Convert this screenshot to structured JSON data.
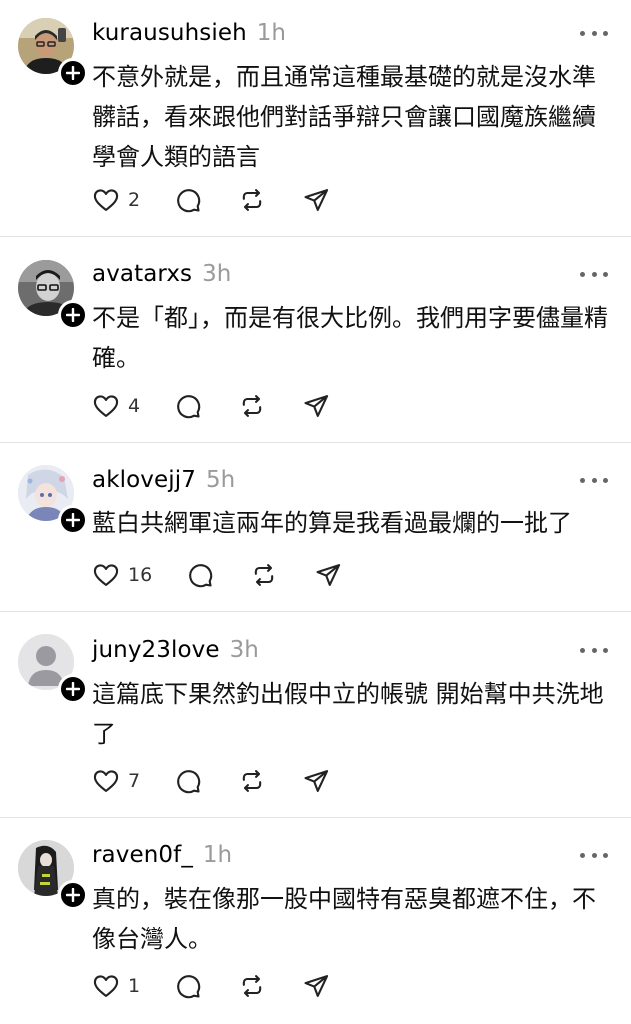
{
  "posts": [
    {
      "username": "kurausuhsieh",
      "time": "1h",
      "text": "不意外就是，而且通常這種最基礎的就是沒水準髒話，看來跟他們對話爭辯只會讓口國魔族繼續學會人類的語言",
      "likes": "2",
      "avatar": "photo-man-glasses"
    },
    {
      "username": "avatarxs",
      "time": "3h",
      "text": "不是「都」，而是有很大比例。我們用字要儘量精確。",
      "likes": "4",
      "avatar": "photo-man-glasses-bw"
    },
    {
      "username": "aklovejj7",
      "time": "5h",
      "text": "藍白共網軍這兩年的算是我看過最爛的一批了",
      "likes": "16",
      "avatar": "anime-character"
    },
    {
      "username": "juny23love",
      "time": "3h",
      "text": "這篇底下果然釣出假中立的帳號 開始幫中共洗地了",
      "likes": "7",
      "avatar": "default-avatar"
    },
    {
      "username": "raven0f_",
      "time": "1h",
      "text": "真的，裝在像那一股中國特有惡臭都遮不住，不像台灣人。",
      "likes": "1",
      "avatar": "anime-dark-character"
    }
  ],
  "icons": {
    "like": "heart-icon",
    "reply": "comment-icon",
    "repost": "repost-icon",
    "share": "send-icon",
    "more": "more-icon",
    "follow": "plus-icon"
  },
  "colors": {
    "text": "#000000",
    "muted": "#9a9a9a",
    "divider": "#e3e3e3"
  }
}
